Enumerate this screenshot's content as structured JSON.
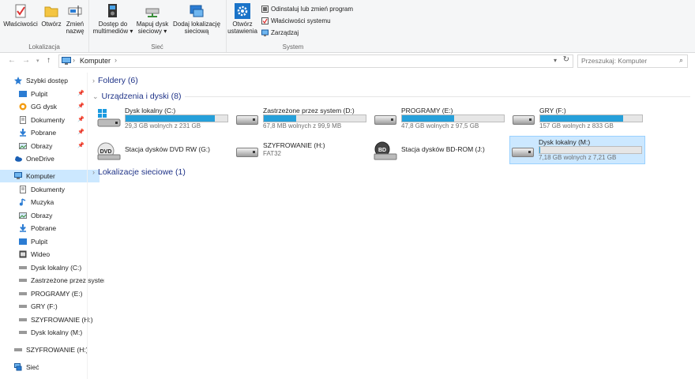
{
  "ribbon": {
    "groups": [
      {
        "label": "Lokalizacja"
      },
      {
        "label": "Sieć"
      },
      {
        "label": "System"
      }
    ],
    "buttons": {
      "properties": "Właściwości",
      "open": "Otwórz",
      "rename_1": "Zmień",
      "rename_2": "nazwę",
      "media_1": "Dostęp do",
      "media_2": "multimediów",
      "mapdrive_1": "Mapuj dysk",
      "mapdrive_2": "sieciowy",
      "addloc_1": "Dodaj lokalizację",
      "addloc_2": "sieciową",
      "settings_1": "Otwórz",
      "settings_2": "ustawienia",
      "uninstall": "Odinstaluj lub zmień program",
      "sysprops": "Właściwości systemu",
      "manage": "Zarządzaj"
    }
  },
  "address": {
    "path": "Komputer",
    "search_placeholder": "Przeszukaj: Komputer"
  },
  "nav": {
    "quick": "Szybki dostęp",
    "quick_items": [
      "Pulpit",
      "GG dysk",
      "Dokumenty",
      "Pobrane",
      "Obrazy"
    ],
    "onedrive": "OneDrive",
    "computer": "Komputer",
    "computer_items": [
      "Dokumenty",
      "Muzyka",
      "Obrazy",
      "Pobrane",
      "Pulpit",
      "Wideo",
      "Dysk lokalny (C:)",
      "Zastrzeżone przez system (D:)",
      "PROGRAMY (E:)",
      "GRY (F:)",
      "SZYFROWANIE (H:)",
      "Dysk lokalny (M:)"
    ],
    "encrypt": "SZYFROWANIE (H:)",
    "network": "Sieć"
  },
  "content": {
    "folders": "Foldery (6)",
    "devices": "Urządzenia i dyski (8)",
    "netloc": "Lokalizacje sieciowe (1)",
    "drives": [
      {
        "name": "Dysk lokalny (C:)",
        "free": "29,3 GB wolnych z 231 GB",
        "used_fraction": 0.873
      },
      {
        "name": "Zastrzeżone przez system (D:)",
        "free": "67,8 MB wolnych z 99,9 MB",
        "used_fraction": 0.321
      },
      {
        "name": "PROGRAMY (E:)",
        "free": "47,8 GB wolnych z 97,5 GB",
        "used_fraction": 0.51
      },
      {
        "name": "GRY (F:)",
        "free": "157 GB wolnych z 833 GB",
        "used_fraction": 0.812
      },
      {
        "name": "Stacja dysków DVD RW (G:)"
      },
      {
        "name": "SZYFROWANIE (H:)",
        "sub": "FAT32"
      },
      {
        "name": "Stacja dysków BD-ROM (J:)"
      },
      {
        "name": "Dysk lokalny (M:)",
        "free": "7,18 GB wolnych z 7,21 GB",
        "used_fraction": 0.004
      }
    ]
  }
}
